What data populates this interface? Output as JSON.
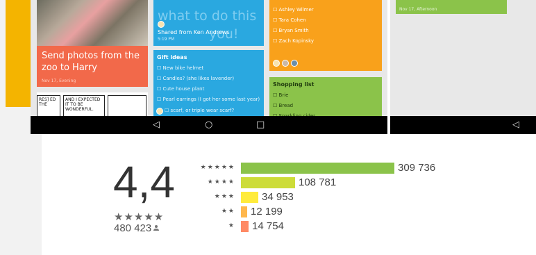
{
  "screenshot1": {
    "photo_card": {
      "title": "Send photos from the zoo to Harry",
      "meta": "Nov 17, Evening"
    },
    "comic_card": {
      "text_a": "RES] ED THE",
      "text_b": "AND I EXPECTED IT TO BE WONDERFUL."
    },
    "share_card": {
      "big_text": "what to do this",
      "big_text2": "you!",
      "shared_from": "Shared from Ken Andrews",
      "time": "5:19 PM"
    },
    "gift_card": {
      "heading": "Gift ideas",
      "items": [
        "New bike helmet",
        "Candles? (she likes lavender)",
        "Cute house plant",
        "Pearl earrings (I got her some last year)",
        "scarf, or triple wear scarf?"
      ]
    },
    "names_card": {
      "items": [
        "Ashley Wilmer",
        "Tara Cohen",
        "Bryan Smith",
        "Zach Kopinsky"
      ]
    },
    "shopping_card": {
      "heading": "Shopping list",
      "items": [
        "Brie",
        "Bread",
        "Sparkling cider"
      ]
    },
    "nav": {
      "back": "◁",
      "home": "○",
      "recent": "□"
    }
  },
  "screenshot2": {
    "green_card": {
      "meta": "Nov 17, Afternoon"
    },
    "nav": {
      "back": "◁"
    }
  },
  "rating": {
    "average": "4,4",
    "stars": "★★★★★",
    "total": "480 423",
    "histogram": [
      {
        "label": "★★★★★",
        "count": "309 736",
        "value": 309736,
        "color": "#8bc34a"
      },
      {
        "label": "★★★★",
        "count": "108 781",
        "value": 108781,
        "color": "#cddc39"
      },
      {
        "label": "★★★",
        "count": "34 953",
        "value": 34953,
        "color": "#ffeb3b"
      },
      {
        "label": "★★",
        "count": "12 199",
        "value": 12199,
        "color": "#ffb74d"
      },
      {
        "label": "★",
        "count": "14 754",
        "value": 14754,
        "color": "#ff8a65"
      }
    ]
  }
}
